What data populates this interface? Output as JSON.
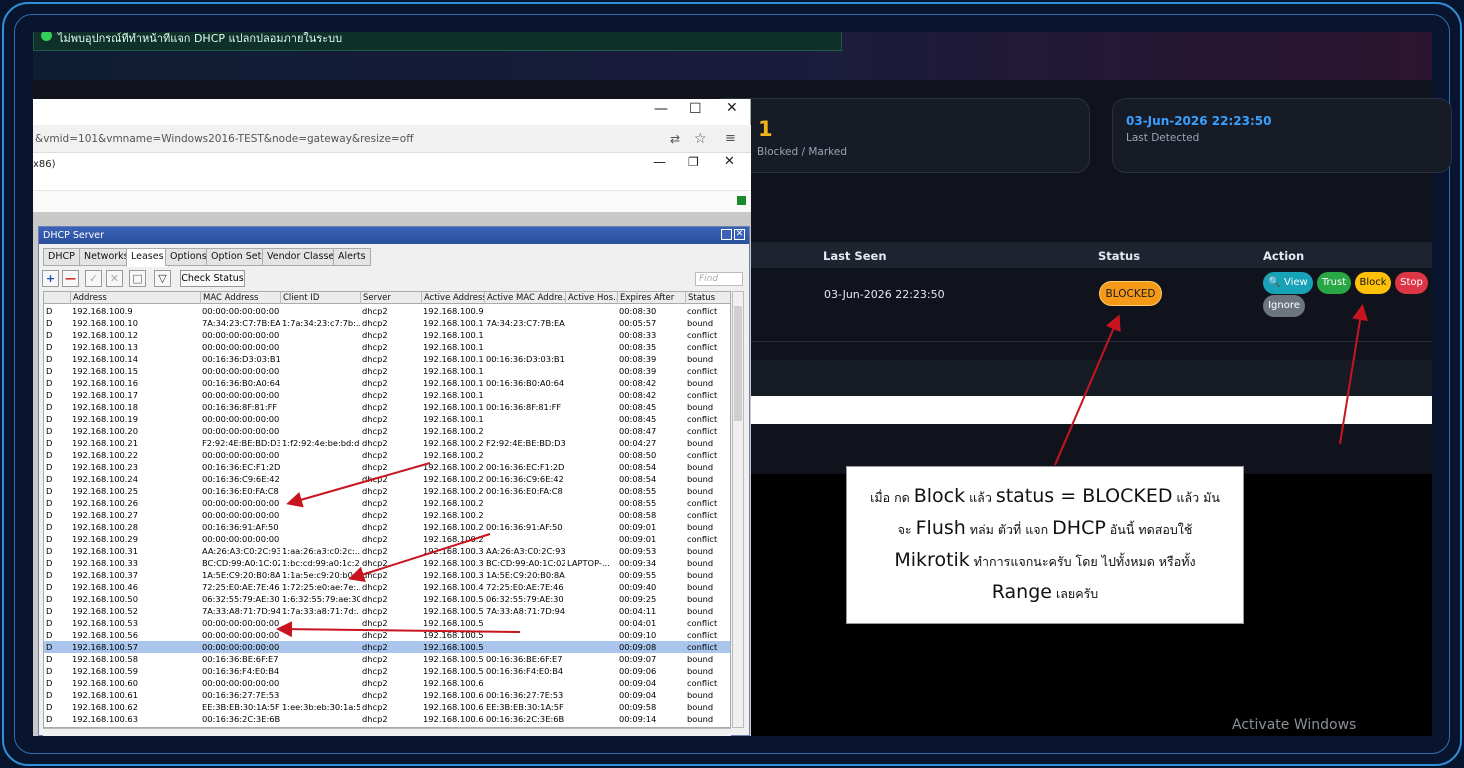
{
  "alert": {
    "text": "ไม่พบอุปกรณ์ที่ทำหน้าที่แจก DHCP แปลกปลอมภายในระบบ"
  },
  "cards": [
    {
      "value": "1",
      "label": "Blocked / Marked"
    },
    {
      "value": "03-Jun-2026 22:23:50",
      "label": "Last Detected"
    }
  ],
  "table": {
    "headers": {
      "last_seen": "Last Seen",
      "status": "Status",
      "action": "Action"
    },
    "row": {
      "last_seen": "03-Jun-2026 22:23:50",
      "status": "BLOCKED"
    },
    "actions": {
      "view": "View",
      "trust": "Trust",
      "block": "Block",
      "stop": "Stop",
      "ignore": "Ignore"
    }
  },
  "browser": {
    "url": "&vmid=101&vmname=Windows2016-TEST&node=gateway&resize=off",
    "subtitle": "x86)"
  },
  "dhcp": {
    "title": "DHCP Server",
    "tabs": [
      "DHCP",
      "Networks",
      "Leases",
      "Options",
      "Option Sets",
      "Vendor Classes",
      "Alerts"
    ],
    "active_tab": "Leases",
    "check_status": "Check Status",
    "find_placeholder": "Find",
    "columns": [
      "Address",
      "MAC Address",
      "Client ID",
      "Server",
      "Active Address",
      "Active MAC Addre...",
      "Active Hos...",
      "Expires After",
      "Status"
    ],
    "rows": [
      [
        "D",
        "192.168.100.9",
        "00:00:00:00:00:00",
        "",
        "dhcp2",
        "192.168.100.9",
        "",
        "",
        "00:08:30",
        "conflict"
      ],
      [
        "D",
        "192.168.100.10",
        "7A:34:23:C7:7B:EA",
        "1:7a:34:23:c7:7b:...",
        "dhcp2",
        "192.168.100.10",
        "7A:34:23:C7:7B:EA",
        "",
        "00:05:57",
        "bound"
      ],
      [
        "D",
        "192.168.100.12",
        "00:00:00:00:00:00",
        "",
        "dhcp2",
        "192.168.100.12",
        "",
        "",
        "00:08:33",
        "conflict"
      ],
      [
        "D",
        "192.168.100.13",
        "00:00:00:00:00:00",
        "",
        "dhcp2",
        "192.168.100.13",
        "",
        "",
        "00:08:35",
        "conflict"
      ],
      [
        "D",
        "192.168.100.14",
        "00:16:36:D3:03:B1",
        "",
        "dhcp2",
        "192.168.100.14",
        "00:16:36:D3:03:B1",
        "",
        "00:08:39",
        "bound"
      ],
      [
        "D",
        "192.168.100.15",
        "00:00:00:00:00:00",
        "",
        "dhcp2",
        "192.168.100.15",
        "",
        "",
        "00:08:39",
        "conflict"
      ],
      [
        "D",
        "192.168.100.16",
        "00:16:36:B0:A0:64",
        "",
        "dhcp2",
        "192.168.100.16",
        "00:16:36:B0:A0:64",
        "",
        "00:08:42",
        "bound"
      ],
      [
        "D",
        "192.168.100.17",
        "00:00:00:00:00:00",
        "",
        "dhcp2",
        "192.168.100.17",
        "",
        "",
        "00:08:42",
        "conflict"
      ],
      [
        "D",
        "192.168.100.18",
        "00:16:36:8F:81:FF",
        "",
        "dhcp2",
        "192.168.100.18",
        "00:16:36:8F:81:FF",
        "",
        "00:08:45",
        "bound"
      ],
      [
        "D",
        "192.168.100.19",
        "00:00:00:00:00:00",
        "",
        "dhcp2",
        "192.168.100.19",
        "",
        "",
        "00:08:45",
        "conflict"
      ],
      [
        "D",
        "192.168.100.20",
        "00:00:00:00:00:00",
        "",
        "dhcp2",
        "192.168.100.20",
        "",
        "",
        "00:08:47",
        "conflict"
      ],
      [
        "D",
        "192.168.100.21",
        "F2:92:4E:BE:BD:D3",
        "1:f2:92:4e:be:bd:d3",
        "dhcp2",
        "192.168.100.21",
        "F2:92:4E:BE:BD:D3",
        "",
        "00:04:27",
        "bound"
      ],
      [
        "D",
        "192.168.100.22",
        "00:00:00:00:00:00",
        "",
        "dhcp2",
        "192.168.100.22",
        "",
        "",
        "00:08:50",
        "conflict"
      ],
      [
        "D",
        "192.168.100.23",
        "00:16:36:EC:F1:2D",
        "",
        "dhcp2",
        "192.168.100.23",
        "00:16:36:EC:F1:2D",
        "",
        "00:08:54",
        "bound"
      ],
      [
        "D",
        "192.168.100.24",
        "00:16:36:C9:6E:42",
        "",
        "dhcp2",
        "192.168.100.24",
        "00:16:36:C9:6E:42",
        "",
        "00:08:54",
        "bound"
      ],
      [
        "D",
        "192.168.100.25",
        "00:16:36:E0:FA:C8",
        "",
        "dhcp2",
        "192.168.100.25",
        "00:16:36:E0:FA:C8",
        "",
        "00:08:55",
        "bound"
      ],
      [
        "D",
        "192.168.100.26",
        "00:00:00:00:00:00",
        "",
        "dhcp2",
        "192.168.100.26",
        "",
        "",
        "00:08:55",
        "conflict"
      ],
      [
        "D",
        "192.168.100.27",
        "00:00:00:00:00:00",
        "",
        "dhcp2",
        "192.168.100.27",
        "",
        "",
        "00:08:58",
        "conflict"
      ],
      [
        "D",
        "192.168.100.28",
        "00:16:36:91:AF:50",
        "",
        "dhcp2",
        "192.168.100.28",
        "00:16:36:91:AF:50",
        "",
        "00:09:01",
        "bound"
      ],
      [
        "D",
        "192.168.100.29",
        "00:00:00:00:00:00",
        "",
        "dhcp2",
        "192.168.100.29",
        "",
        "",
        "00:09:01",
        "conflict"
      ],
      [
        "D",
        "192.168.100.31",
        "AA:26:A3:C0:2C:93",
        "1:aa:26:a3:c0:2c:...",
        "dhcp2",
        "192.168.100.31",
        "AA:26:A3:C0:2C:93",
        "",
        "00:09:53",
        "bound"
      ],
      [
        "D",
        "192.168.100.33",
        "BC:CD:99:A0:1C:02",
        "1:bc:cd:99:a0:1c:2",
        "dhcp2",
        "192.168.100.33",
        "BC:CD:99:A0:1C:02",
        "LAPTOP-...",
        "00:09:34",
        "bound"
      ],
      [
        "D",
        "192.168.100.37",
        "1A:5E:C9:20:B0:8A",
        "1:1a:5e:c9:20:b0:...",
        "dhcp2",
        "192.168.100.37",
        "1A:5E:C9:20:B0:8A",
        "",
        "00:09:55",
        "bound"
      ],
      [
        "D",
        "192.168.100.46",
        "72:25:E0:AE:7E:46",
        "1:72:25:e0:ae:7e:...",
        "dhcp2",
        "192.168.100.46",
        "72:25:E0:AE:7E:46",
        "",
        "00:09:40",
        "bound"
      ],
      [
        "D",
        "192.168.100.50",
        "06:32:55:79:AE:30",
        "1:6:32:55:79:ae:30",
        "dhcp2",
        "192.168.100.50",
        "06:32:55:79:AE:30",
        "",
        "00:09:25",
        "bound"
      ],
      [
        "D",
        "192.168.100.52",
        "7A:33:A8:71:7D:94",
        "1:7a:33:a8:71:7d:...",
        "dhcp2",
        "192.168.100.52",
        "7A:33:A8:71:7D:94",
        "",
        "00:04:11",
        "bound"
      ],
      [
        "D",
        "192.168.100.53",
        "00:00:00:00:00:00",
        "",
        "dhcp2",
        "192.168.100.53",
        "",
        "",
        "00:04:01",
        "conflict"
      ],
      [
        "D",
        "192.168.100.56",
        "00:00:00:00:00:00",
        "",
        "dhcp2",
        "192.168.100.56",
        "",
        "",
        "00:09:10",
        "conflict"
      ],
      [
        "D",
        "192.168.100.57",
        "00:00:00:00:00:00",
        "",
        "dhcp2",
        "192.168.100.57",
        "",
        "",
        "00:09:08",
        "conflict"
      ],
      [
        "D",
        "192.168.100.58",
        "00:16:36:BE:6F:E7",
        "",
        "dhcp2",
        "192.168.100.58",
        "00:16:36:BE:6F:E7",
        "",
        "00:09:07",
        "bound"
      ],
      [
        "D",
        "192.168.100.59",
        "00:16:36:F4:E0:B4",
        "",
        "dhcp2",
        "192.168.100.59",
        "00:16:36:F4:E0:B4",
        "",
        "00:09:06",
        "bound"
      ],
      [
        "D",
        "192.168.100.60",
        "00:00:00:00:00:00",
        "",
        "dhcp2",
        "192.168.100.60",
        "",
        "",
        "00:09:04",
        "conflict"
      ],
      [
        "D",
        "192.168.100.61",
        "00:16:36:27:7E:53",
        "",
        "dhcp2",
        "192.168.100.61",
        "00:16:36:27:7E:53",
        "",
        "00:09:04",
        "bound"
      ],
      [
        "D",
        "192.168.100.62",
        "EE:3B:EB:30:1A:5F",
        "1:ee:3b:eb:30:1a:5f",
        "dhcp2",
        "192.168.100.62",
        "EE:3B:EB:30:1A:5F",
        "",
        "00:09:58",
        "bound"
      ],
      [
        "D",
        "192.168.100.63",
        "00:16:36:2C:3E:6B",
        "",
        "dhcp2",
        "192.168.100.63",
        "00:16:36:2C:3E:6B",
        "",
        "00:09:14",
        "bound"
      ]
    ],
    "selected_row": 28
  },
  "annotation": {
    "line1": [
      "เมื่อ กด ",
      "Block",
      " แล้ว ",
      "status = BLOCKED",
      " แล้ว มัน"
    ],
    "line2": [
      "จะ ",
      "Flush",
      " ทล่ม ตัวที่ แจก ",
      "DHCP",
      " อันนี้ ทดสอบใช้"
    ],
    "line3": [
      "Mikrotik",
      " ทำการแจกนะครับ โดย ไปทั้งหมด หรือทั้ง"
    ],
    "line4": [
      "Range",
      " เลยครับ"
    ]
  },
  "watermark": "Activate Windows",
  "colors": {
    "accent_blue": "#3aa0ff",
    "blocked_orange": "#f49a18",
    "arrow_red": "#c8141e",
    "frame_blue": "#2f8fd8"
  }
}
